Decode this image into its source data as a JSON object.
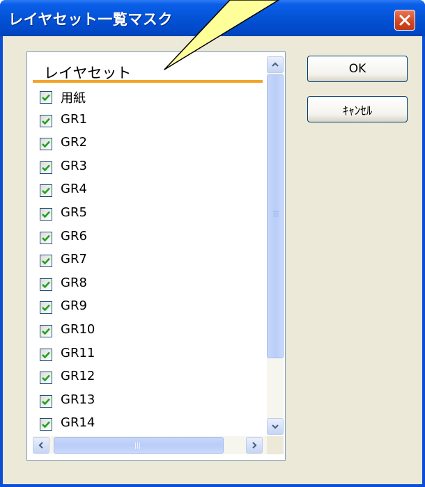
{
  "window": {
    "title": "レイヤセット一覧マスク"
  },
  "list": {
    "header": "レイヤセット",
    "items": [
      {
        "label": "用紙",
        "checked": true
      },
      {
        "label": "GR1",
        "checked": true
      },
      {
        "label": "GR2",
        "checked": true
      },
      {
        "label": "GR3",
        "checked": true
      },
      {
        "label": "GR4",
        "checked": true
      },
      {
        "label": "GR5",
        "checked": true
      },
      {
        "label": "GR6",
        "checked": true
      },
      {
        "label": "GR7",
        "checked": true
      },
      {
        "label": "GR8",
        "checked": true
      },
      {
        "label": "GR9",
        "checked": true
      },
      {
        "label": "GR10",
        "checked": true
      },
      {
        "label": "GR11",
        "checked": true
      },
      {
        "label": "GR12",
        "checked": true
      },
      {
        "label": "GR13",
        "checked": true
      },
      {
        "label": "GR14",
        "checked": true
      }
    ]
  },
  "buttons": {
    "ok": "OK",
    "cancel": "ｷｬﾝｾﾙ"
  },
  "colors": {
    "titlebar": "#0453d6",
    "highlight": "#f3a52b",
    "check": "#21a121",
    "callout": "#ffff99"
  }
}
